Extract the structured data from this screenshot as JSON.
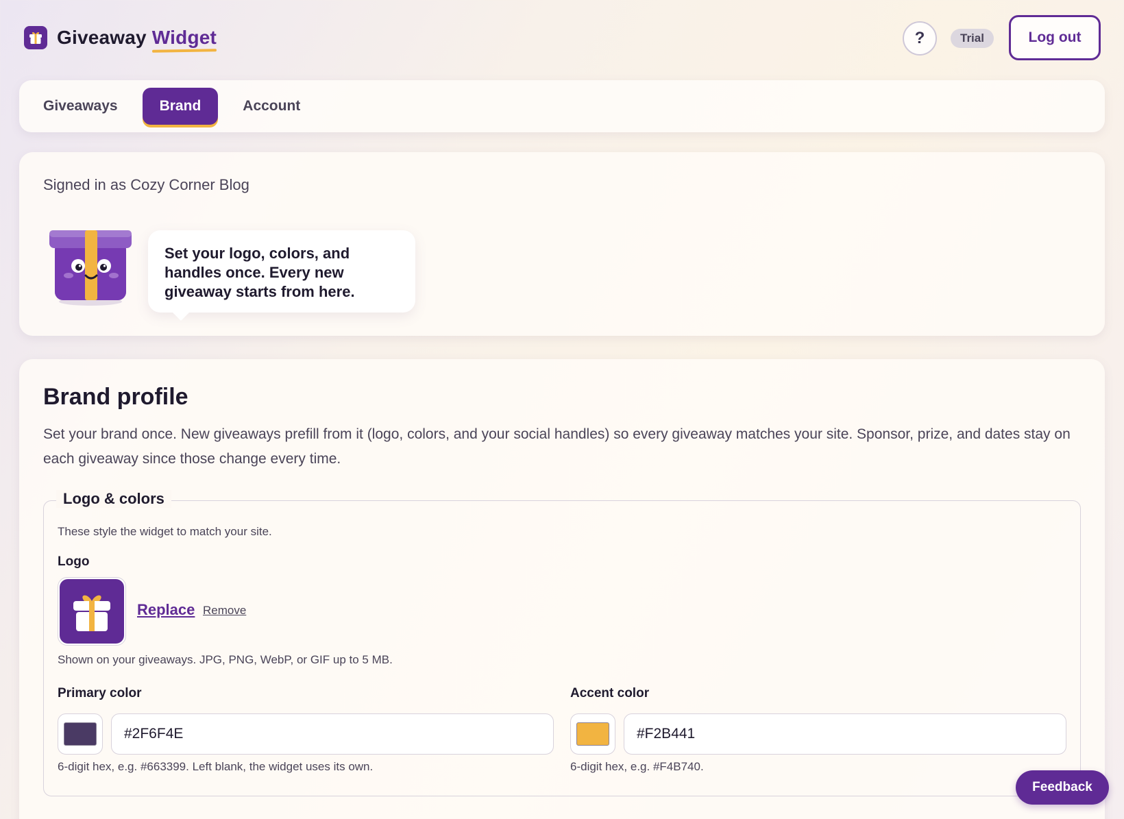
{
  "header": {
    "brand_name": "Giveaway",
    "brand_accent": "Widget",
    "help_label": "?",
    "plan_badge": "Trial",
    "logout_label": "Log out"
  },
  "tabs": [
    {
      "label": "Giveaways",
      "active": false
    },
    {
      "label": "Brand",
      "active": true
    },
    {
      "label": "Account",
      "active": false
    }
  ],
  "intro": {
    "signed_in_text": "Signed in as Cozy Corner Blog",
    "bubble_text": "Set your logo, colors, and handles once. Every new giveaway starts from here."
  },
  "profile": {
    "title": "Brand profile",
    "description": "Set your brand once. New giveaways prefill from it (logo, colors, and your social handles) so every giveaway matches your site. Sponsor, prize, and dates stay on each giveaway since those change every time.",
    "section": {
      "legend": "Logo & colors",
      "help": "These style the widget to match your site.",
      "logo_label": "Logo",
      "replace_label": "Replace",
      "remove_label": "Remove",
      "logo_hint": "Shown on your giveaways. JPG, PNG, WebP, or GIF up to 5 MB.",
      "primary": {
        "label": "Primary color",
        "value": "#2F6F4E",
        "swatch_color": "#4a3a64",
        "hint": "6-digit hex, e.g. #663399. Left blank, the widget uses its own."
      },
      "accent": {
        "label": "Accent color",
        "value": "#F2B441",
        "swatch_color": "#f2b441",
        "hint": "6-digit hex, e.g. #F4B740."
      }
    }
  },
  "feedback_label": "Feedback",
  "colors": {
    "brand_purple": "#5f2b95",
    "brand_gold": "#f2b441"
  }
}
